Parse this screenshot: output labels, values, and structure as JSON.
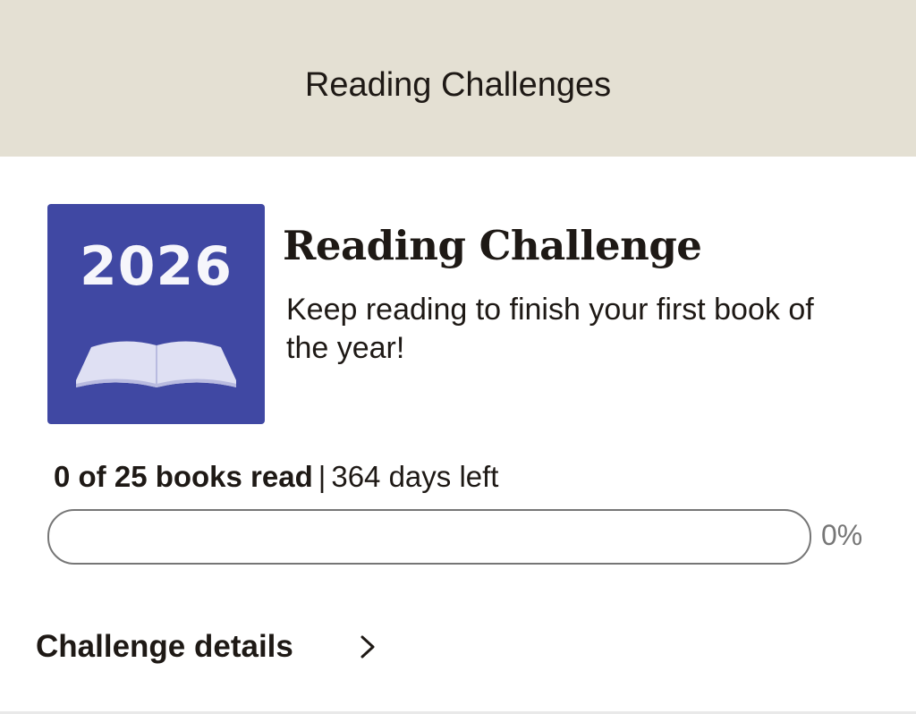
{
  "header": {
    "title": "Reading Challenges"
  },
  "challenge": {
    "cover": {
      "year": "2026",
      "background_color": "#4048a3",
      "icon": "open-book-icon"
    },
    "title": "Reading Challenge",
    "description": "Keep reading to finish your first book of the year!",
    "progress": {
      "books_read_label": "0 of 25 books read",
      "separator": "|",
      "days_left_label": "364 days left",
      "percent_label": "0%",
      "fraction": 0
    },
    "details_link": {
      "label": "Challenge details",
      "icon": "chevron-right-icon"
    }
  },
  "colors": {
    "header_background": "#e4e0d3",
    "text": "#1e1915",
    "muted_text": "#767676",
    "progress_fill": "#409d69"
  }
}
